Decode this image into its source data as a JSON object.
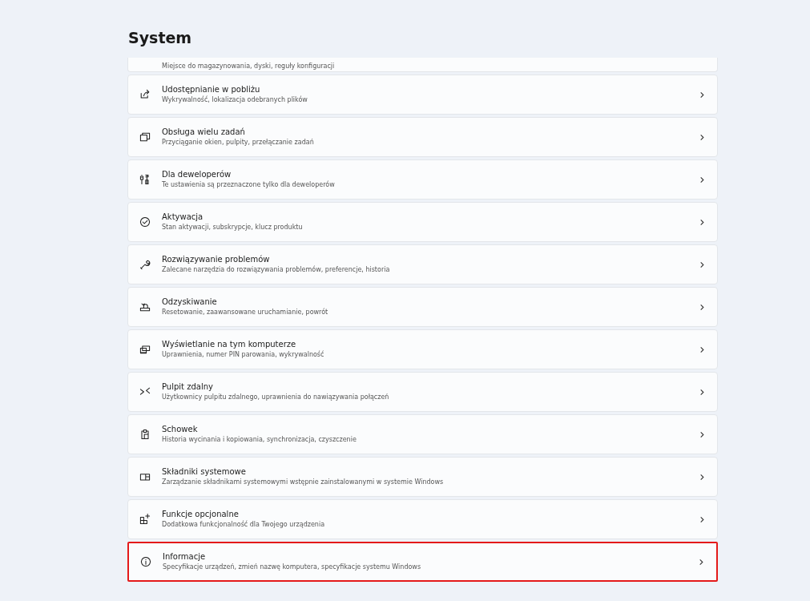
{
  "page": {
    "title": "System"
  },
  "items": [
    {
      "description": "Miejsce do magazynowania, dyski, reguły konfiguracji",
      "partial": true,
      "highlighted": false
    },
    {
      "title": "Udostępnianie w pobliżu",
      "description": "Wykrywalność, lokalizacja odebranych plików",
      "highlighted": false
    },
    {
      "title": "Obsługa wielu zadań",
      "description": "Przyciąganie okien, pulpity, przełączanie zadań",
      "highlighted": false
    },
    {
      "title": "Dla deweloperów",
      "description": "Te ustawienia są przeznaczone tylko dla deweloperów",
      "highlighted": false
    },
    {
      "title": "Aktywacja",
      "description": "Stan aktywacji, subskrypcje, klucz produktu",
      "highlighted": false
    },
    {
      "title": "Rozwiązywanie problemów",
      "description": "Zalecane narzędzia do rozwiązywania problemów, preferencje, historia",
      "highlighted": false
    },
    {
      "title": "Odzyskiwanie",
      "description": "Resetowanie, zaawansowane uruchamianie, powrót",
      "highlighted": false
    },
    {
      "title": "Wyświetlanie na tym komputerze",
      "description": "Uprawnienia, numer PIN parowania, wykrywalność",
      "highlighted": false
    },
    {
      "title": "Pulpit zdalny",
      "description": "Użytkownicy pulpitu zdalnego, uprawnienia do nawiązywania połączeń",
      "highlighted": false
    },
    {
      "title": "Schowek",
      "description": "Historia wycinania i kopiowania, synchronizacja, czyszczenie",
      "highlighted": false
    },
    {
      "title": "Składniki systemowe",
      "description": "Zarządzanie składnikami systemowymi wstępnie zainstalowanymi w systemie Windows",
      "highlighted": false
    },
    {
      "title": "Funkcje opcjonalne",
      "description": "Dodatkowa funkcjonalność dla Twojego urządzenia",
      "highlighted": false
    },
    {
      "title": "Informacje",
      "description": "Specyfikacje urządzeń, zmień nazwę komputera, specyfikacje systemu Windows",
      "highlighted": true
    }
  ]
}
